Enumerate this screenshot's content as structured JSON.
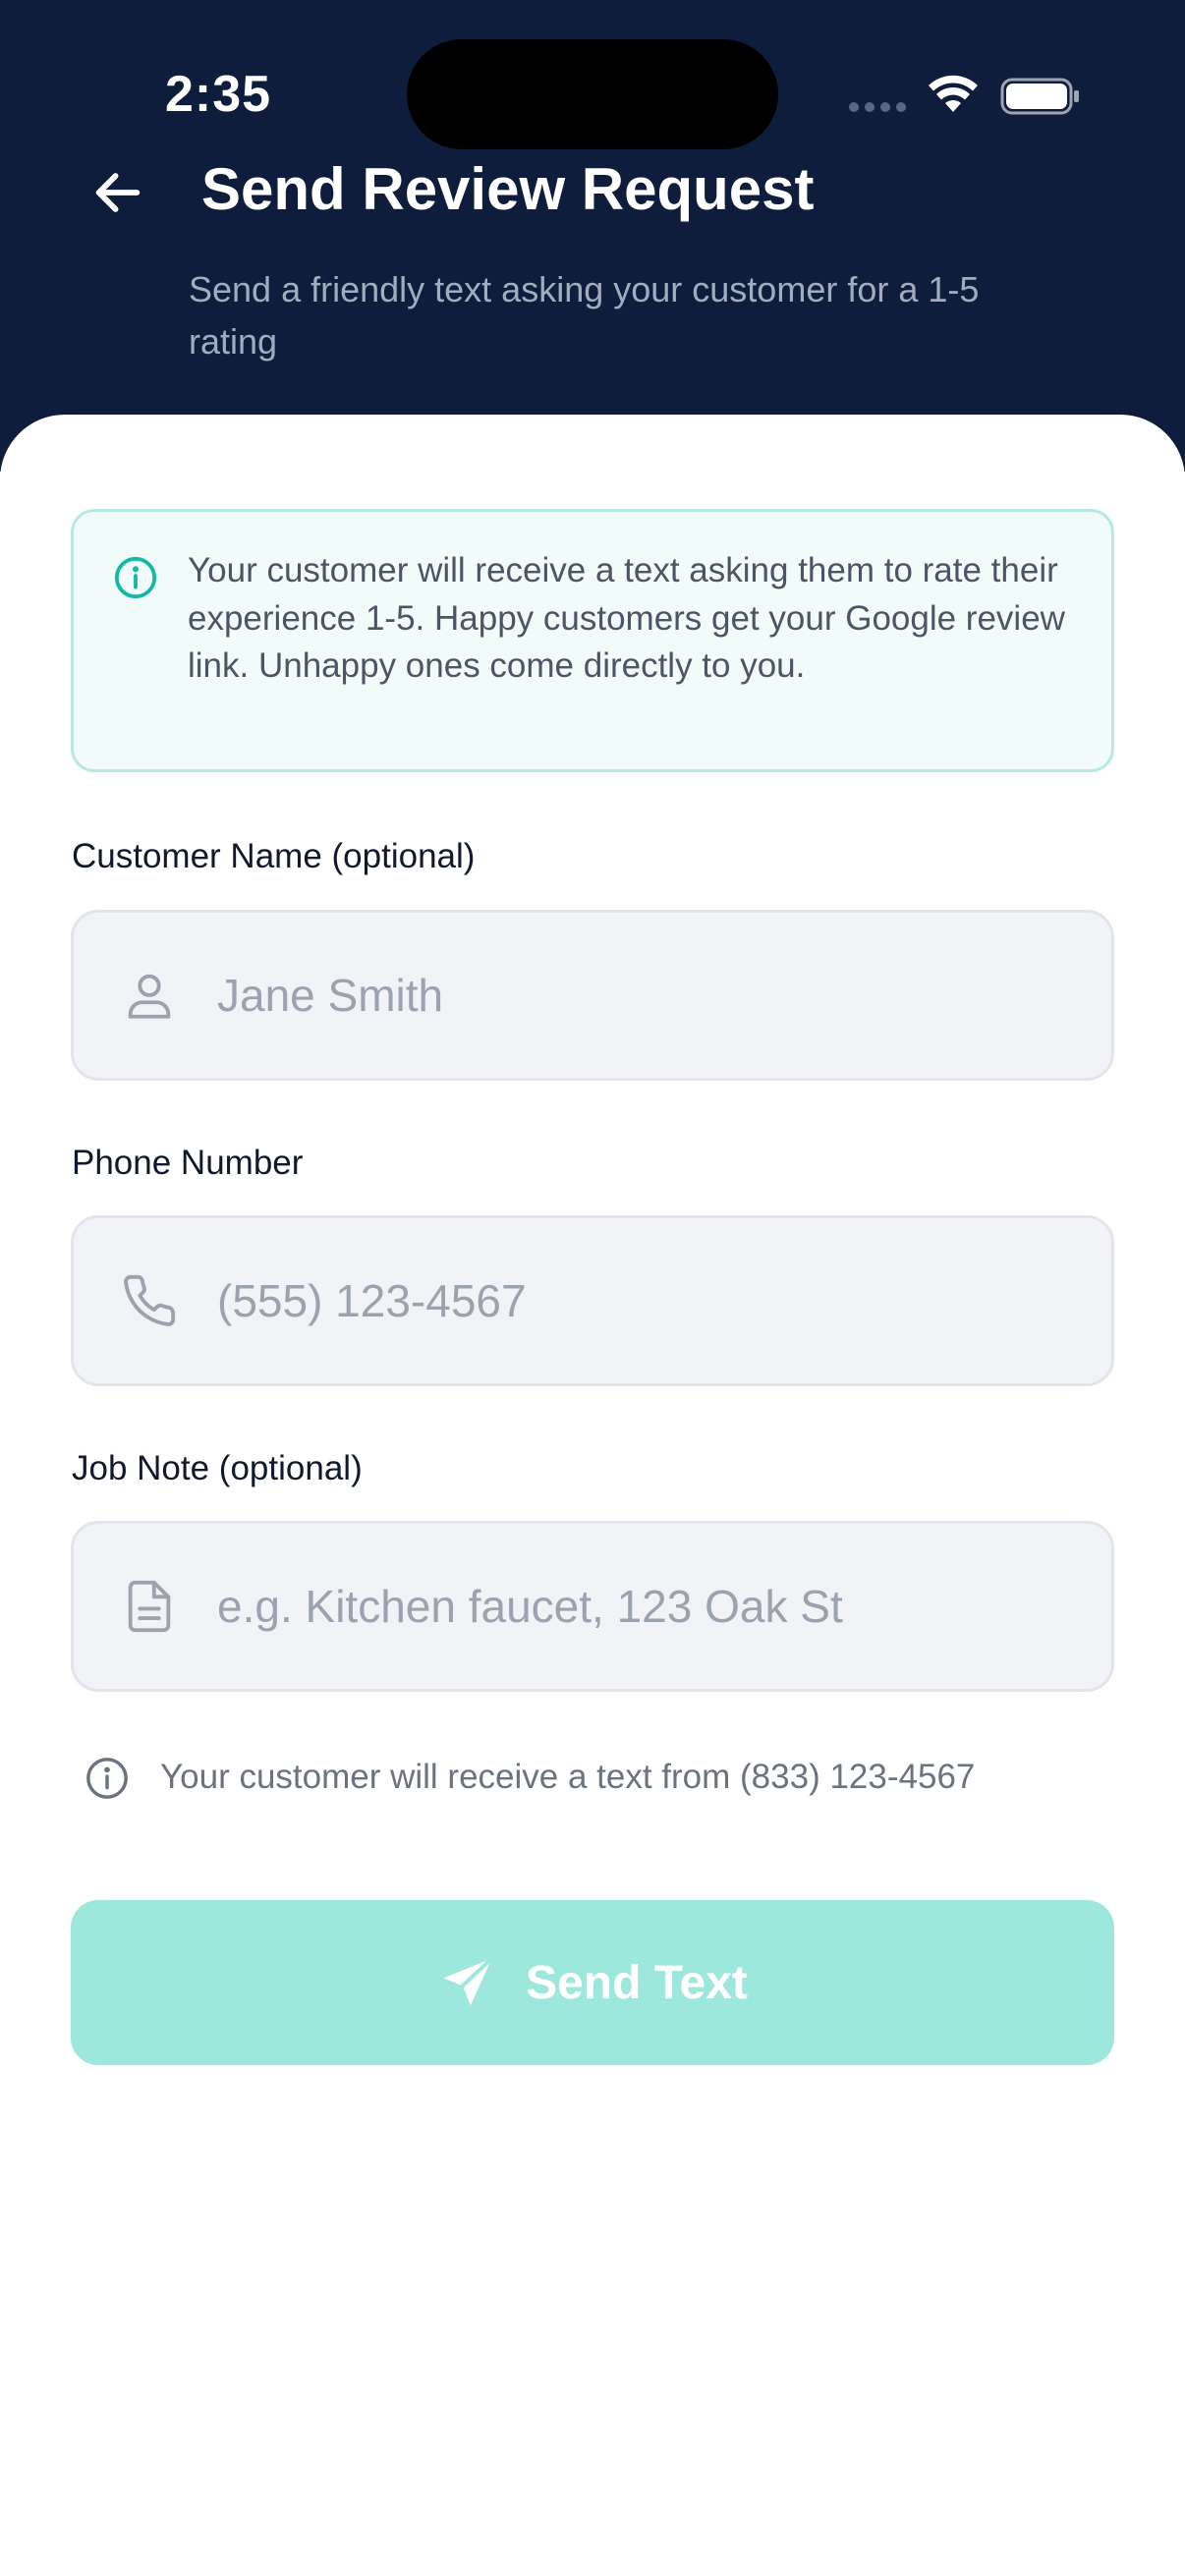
{
  "status_bar": {
    "time": "2:35"
  },
  "header": {
    "title": "Send Review Request",
    "subtitle": "Send a friendly text asking your customer for a 1-5 rating",
    "back_icon": "arrow-left-icon"
  },
  "info_box": {
    "icon": "info-icon",
    "text": "Your customer will receive a text asking them to rate their experience 1-5. Happy customers get your Google review link. Unhappy ones come directly to you."
  },
  "form": {
    "customer_name": {
      "label": "Customer Name (optional)",
      "placeholder": "Jane Smith",
      "value": "",
      "icon": "user-icon"
    },
    "phone_number": {
      "label": "Phone Number",
      "placeholder": "(555) 123-4567",
      "value": "",
      "icon": "phone-icon"
    },
    "job_note": {
      "label": "Job Note (optional)",
      "placeholder": "e.g. Kitchen faucet, 123 Oak St",
      "value": "",
      "icon": "document-icon"
    }
  },
  "from_note": {
    "icon": "info-icon",
    "text": "Your customer will receive a text from (833) 123-4567"
  },
  "send_button": {
    "label": "Send Text",
    "icon": "send-icon"
  },
  "colors": {
    "header_bg": "#0d1d3b",
    "accent": "#14b8a6",
    "button_disabled": "#9ee7dc",
    "info_bg": "#f1fbfa",
    "field_bg": "#f2f3f7"
  }
}
